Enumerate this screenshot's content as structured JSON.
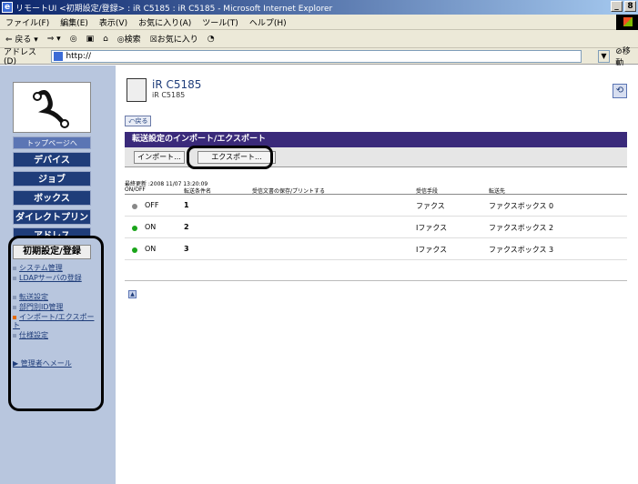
{
  "window": {
    "title": "リモートUI <初期設定/登録> : iR C5185 : iR C5185 - Microsoft Internet Explorer",
    "controls": [
      "_",
      "8"
    ]
  },
  "menubar": [
    "ファイル(F)",
    "編集(E)",
    "表示(V)",
    "お気に入り(A)",
    "ツール(T)",
    "ヘルプ(H)"
  ],
  "toolbar": {
    "back": "⇐ 戻る ▾",
    "forward": "⇒ ▾",
    "stop": "◎",
    "refresh": "▣",
    "home": "⌂",
    "search": "◎検索",
    "favorites": "☒お気に入り",
    "history": "◔"
  },
  "address": {
    "label": "アドレス(D)",
    "url": "http://",
    "go": "⊘移動"
  },
  "sidebar": {
    "top_page": "トップページへ",
    "nav": [
      "デバイス",
      "ジョブ",
      "ボックス",
      "ダイレクトプリント",
      "アドレス"
    ],
    "category": "初期設定/登録",
    "links": [
      {
        "label": "システム管理"
      },
      {
        "label": "LDAPサーバの登録"
      },
      {
        "label": "転送設定"
      },
      {
        "label": "部門別ID管理"
      },
      {
        "label": "インポート/エクスポート",
        "current": true
      },
      {
        "label": "仕様設定"
      }
    ],
    "mailto": "管理者へメール"
  },
  "device": {
    "name": "iR C5185",
    "sub": "iR C5185"
  },
  "back_button": "戻る",
  "panel": {
    "title": "転送設定のインポート/エクスポート",
    "import_button": "インポート...",
    "export_button": "エクスポート..."
  },
  "last_update": "最終更新 :2008 11/07 13:20:09",
  "table": {
    "headers": [
      "ON/OFF",
      "転送条件名",
      "受信文書の保存/プリントする",
      "受信手段",
      "転送先"
    ],
    "rows": [
      {
        "state": "OFF",
        "state_color": "#888888",
        "number": "1",
        "method": "ファクス",
        "destination": "ファクスボックス 0"
      },
      {
        "state": "ON",
        "state_color": "#1aa51a",
        "number": "2",
        "method": "Iファクス",
        "destination": "ファクスボックス 2"
      },
      {
        "state": "ON",
        "state_color": "#1aa51a",
        "number": "3",
        "method": "Iファクス",
        "destination": "ファクスボックス 3"
      }
    ]
  },
  "colors": {
    "sidebar_bg": "#b8c6de",
    "nav_button": "#1f3d7a",
    "panel_bar": "#3a2a7a"
  }
}
